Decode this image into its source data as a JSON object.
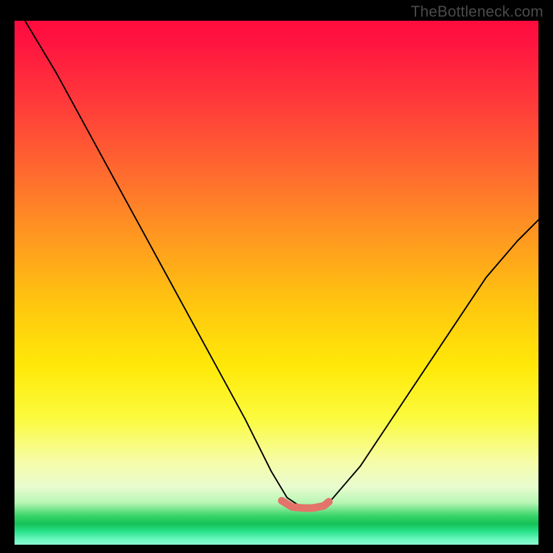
{
  "watermark": "TheBottleneck.com",
  "chart_data": {
    "type": "line",
    "title": "",
    "xlabel": "",
    "ylabel": "",
    "xlim": [
      0,
      100
    ],
    "ylim": [
      0,
      100
    ],
    "series": [
      {
        "name": "main-curve",
        "color": "#000000",
        "x": [
          2,
          8,
          14,
          20,
          26,
          32,
          38,
          44,
          49,
          52,
          55,
          58,
          60,
          66,
          72,
          78,
          84,
          90,
          96,
          100
        ],
        "y": [
          100,
          90,
          79,
          68,
          57,
          46,
          35,
          24,
          14,
          9,
          7,
          7,
          8,
          15,
          24,
          33,
          42,
          51,
          58,
          62
        ]
      },
      {
        "name": "bottom-segment",
        "color": "#e2746b",
        "x": [
          51,
          53,
          55,
          57,
          59,
          60
        ],
        "y": [
          8.4,
          7.2,
          7.0,
          7.0,
          7.4,
          8.2
        ]
      }
    ],
    "gradient_stops": [
      {
        "pos": 0.0,
        "color": "#ff0b3e"
      },
      {
        "pos": 0.3,
        "color": "#ff6e2e"
      },
      {
        "pos": 0.54,
        "color": "#ffc60f"
      },
      {
        "pos": 0.76,
        "color": "#fbfb3f"
      },
      {
        "pos": 0.92,
        "color": "#b7f6b3"
      },
      {
        "pos": 0.96,
        "color": "#14c256"
      },
      {
        "pos": 1.0,
        "color": "#8bf9cf"
      }
    ]
  }
}
